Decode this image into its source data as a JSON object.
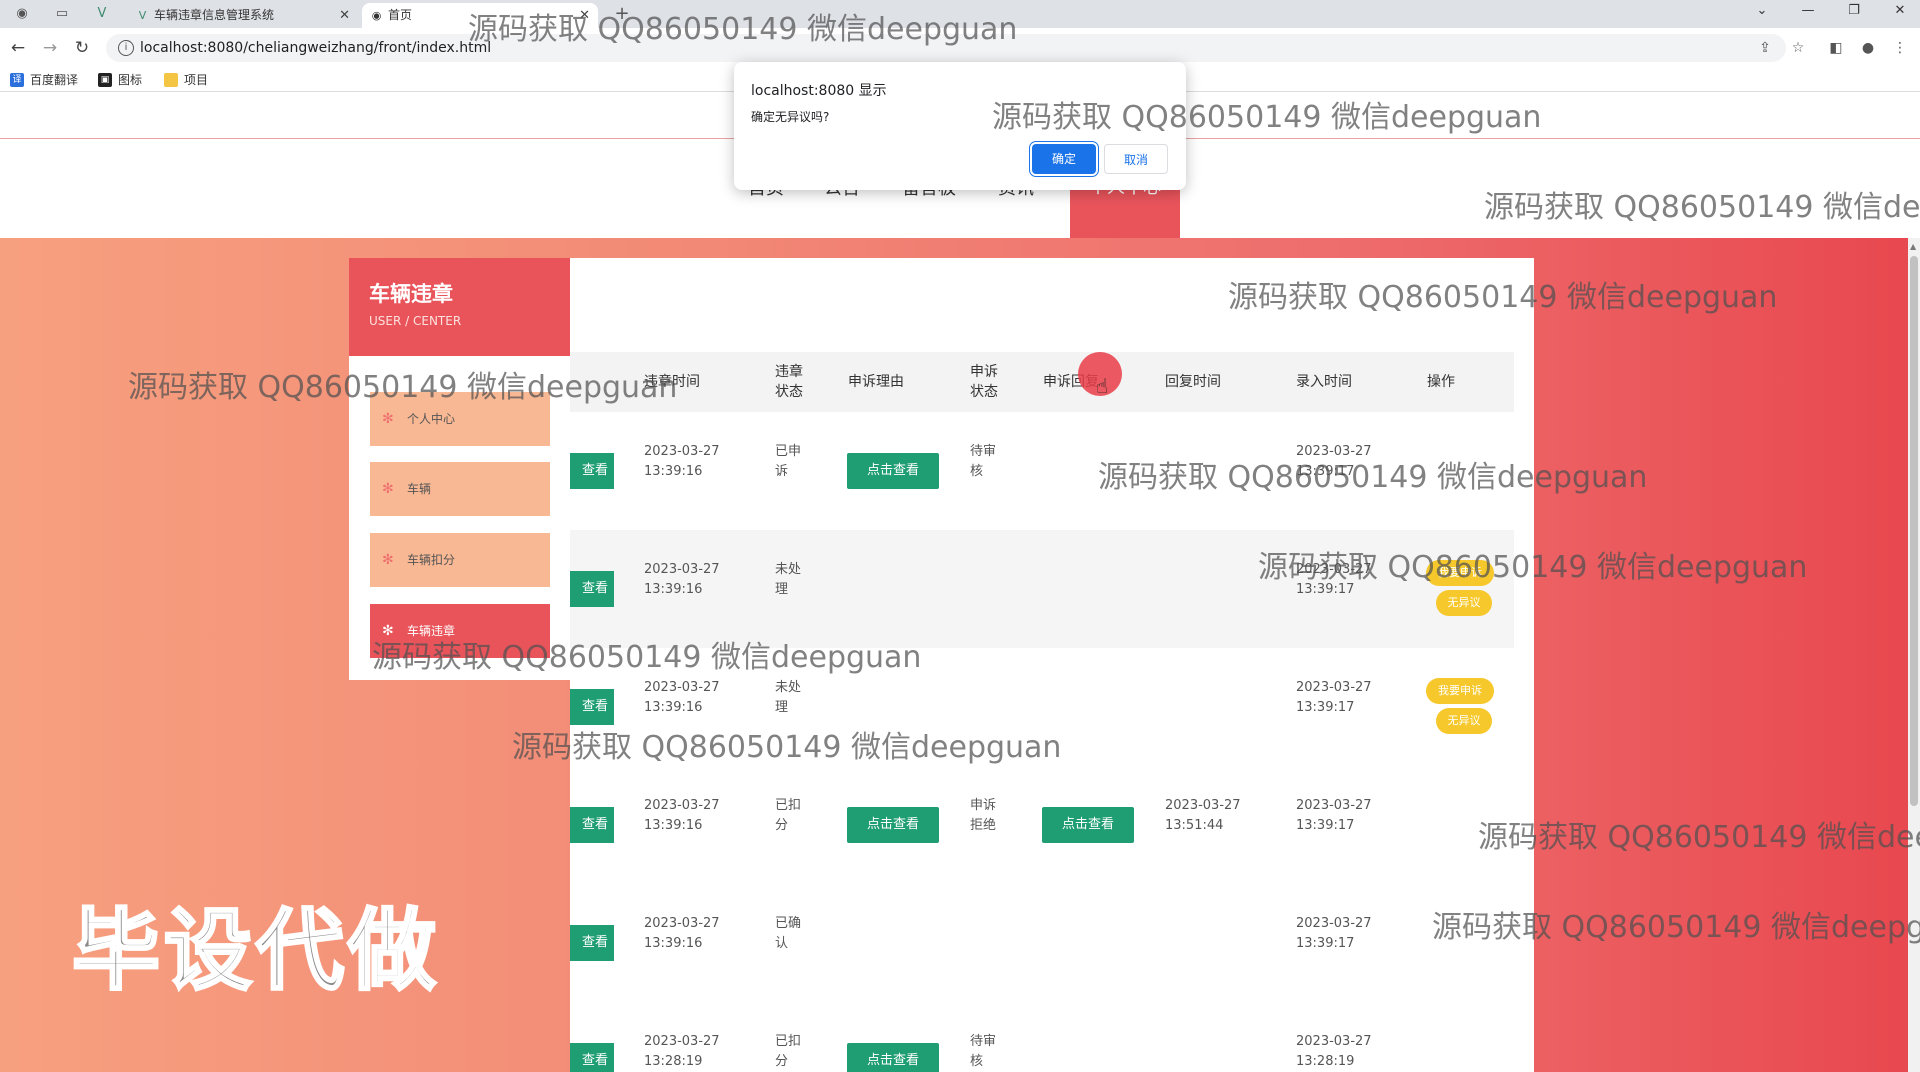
{
  "browser": {
    "tabs": [
      {
        "title": "车辆违章信息管理系统",
        "active": false
      },
      {
        "title": "首页",
        "active": true
      }
    ],
    "new_tab_label": "+",
    "url": "localhost:8080/cheliangweizhang/front/index.html",
    "bookmarks": [
      "百度翻译",
      "图标",
      "项目"
    ]
  },
  "dialog": {
    "title": "localhost:8080 显示",
    "message": "确定无异议吗?",
    "ok_label": "确定",
    "cancel_label": "取消"
  },
  "header": {
    "nav": [
      "首页",
      "公告",
      "留言板",
      "资讯"
    ],
    "nav_active": "个人中心"
  },
  "sidebar": {
    "title": "车辆违章",
    "subtitle": "USER / CENTER",
    "items": [
      {
        "label": "个人中心",
        "active": false
      },
      {
        "label": "车辆",
        "active": false
      },
      {
        "label": "车辆扣分",
        "active": false
      },
      {
        "label": "车辆违章",
        "active": true
      }
    ]
  },
  "table": {
    "headers": [
      "违章时间",
      "违章状态",
      "申诉理由",
      "申诉状态",
      "申诉回复",
      "回复时间",
      "录入时间",
      "操作"
    ],
    "view_label": "查看",
    "click_view_label": "点击查看",
    "rows": [
      {
        "time": "2023-03-27 13:39:16",
        "status": "已申诉",
        "reason": "点击查看",
        "appeal_status": "待审核",
        "reply": "",
        "reply_time": "",
        "entry_time": "2023-03-27 13:39:17",
        "actions": []
      },
      {
        "time": "2023-03-27 13:39:16",
        "status": "未处理",
        "reason": "",
        "appeal_status": "",
        "reply": "",
        "reply_time": "",
        "entry_time": "2023-03-27 13:39:17",
        "actions": [
          "我要申诉",
          "无异议"
        ]
      },
      {
        "time": "2023-03-27 13:39:16",
        "status": "未处理",
        "reason": "",
        "appeal_status": "",
        "reply": "",
        "reply_time": "",
        "entry_time": "2023-03-27 13:39:17",
        "actions": [
          "我要申诉",
          "无异议"
        ]
      },
      {
        "time": "2023-03-27 13:39:16",
        "status": "已扣分",
        "reason": "点击查看",
        "appeal_status": "申诉拒绝",
        "reply": "点击查看",
        "reply_time": "2023-03-27 13:51:44",
        "entry_time": "2023-03-27 13:39:17",
        "actions": []
      },
      {
        "time": "2023-03-27 13:39:16",
        "status": "已确认",
        "reason": "",
        "appeal_status": "",
        "reply": "",
        "reply_time": "",
        "entry_time": "2023-03-27 13:39:17",
        "actions": []
      },
      {
        "time": "2023-03-27 13:28:19",
        "status": "已扣分",
        "reason": "点击查看",
        "appeal_status": "待审核",
        "reply": "",
        "reply_time": "",
        "entry_time": "2023-03-27 13:28:19",
        "actions": []
      }
    ]
  },
  "overlay_label": "毕设代做",
  "watermark_text": "源码获取 QQ86050149 微信deepguan"
}
